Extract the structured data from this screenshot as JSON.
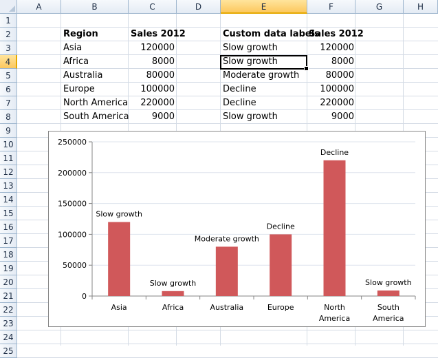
{
  "columns": [
    "A",
    "B",
    "C",
    "D",
    "E",
    "F",
    "G",
    "H"
  ],
  "active_column": "E",
  "rows": [
    "1",
    "2",
    "3",
    "4",
    "5",
    "6",
    "7",
    "8",
    "9",
    "10",
    "11",
    "12",
    "13",
    "14",
    "15",
    "16",
    "17",
    "18",
    "19",
    "20",
    "21",
    "22",
    "23",
    "24",
    "25"
  ],
  "active_row": "4",
  "table": {
    "header": {
      "region": "Region",
      "sales": "Sales 2012",
      "custom": "Custom data labels",
      "sales2": "Sales 2012"
    },
    "rows": [
      {
        "region": "Asia",
        "sales": "120000",
        "label": "Slow growth",
        "sales2": "120000"
      },
      {
        "region": "Africa",
        "sales": "8000",
        "label": "Slow growth",
        "sales2": "8000"
      },
      {
        "region": "Australia",
        "sales": "80000",
        "label": "Moderate growth",
        "sales2": "80000"
      },
      {
        "region": "Europe",
        "sales": "100000",
        "label": "Decline",
        "sales2": "100000"
      },
      {
        "region": "North America",
        "sales": "220000",
        "label": "Decline",
        "sales2": "220000"
      },
      {
        "region": "South America",
        "sales": "9000",
        "label": "Slow growth",
        "sales2": "9000"
      }
    ]
  },
  "colors": {
    "bar": "#d0585a",
    "gridline": "#dfe4ee",
    "header_active": "#fcc85e"
  },
  "chart_data": {
    "type": "bar",
    "categories": [
      [
        "Asia"
      ],
      [
        "Africa"
      ],
      [
        "Australia"
      ],
      [
        "Europe"
      ],
      [
        "North",
        "America"
      ],
      [
        "South",
        "America"
      ]
    ],
    "values": [
      120000,
      8000,
      80000,
      100000,
      220000,
      9000
    ],
    "data_labels": [
      "Slow growth",
      "Slow growth",
      "Moderate growth",
      "Decline",
      "Decline",
      "Slow growth"
    ],
    "y_ticks": [
      "0",
      "50000",
      "100000",
      "150000",
      "200000",
      "250000"
    ],
    "ylim": [
      0,
      250000
    ],
    "grid": true,
    "legend": "none"
  }
}
